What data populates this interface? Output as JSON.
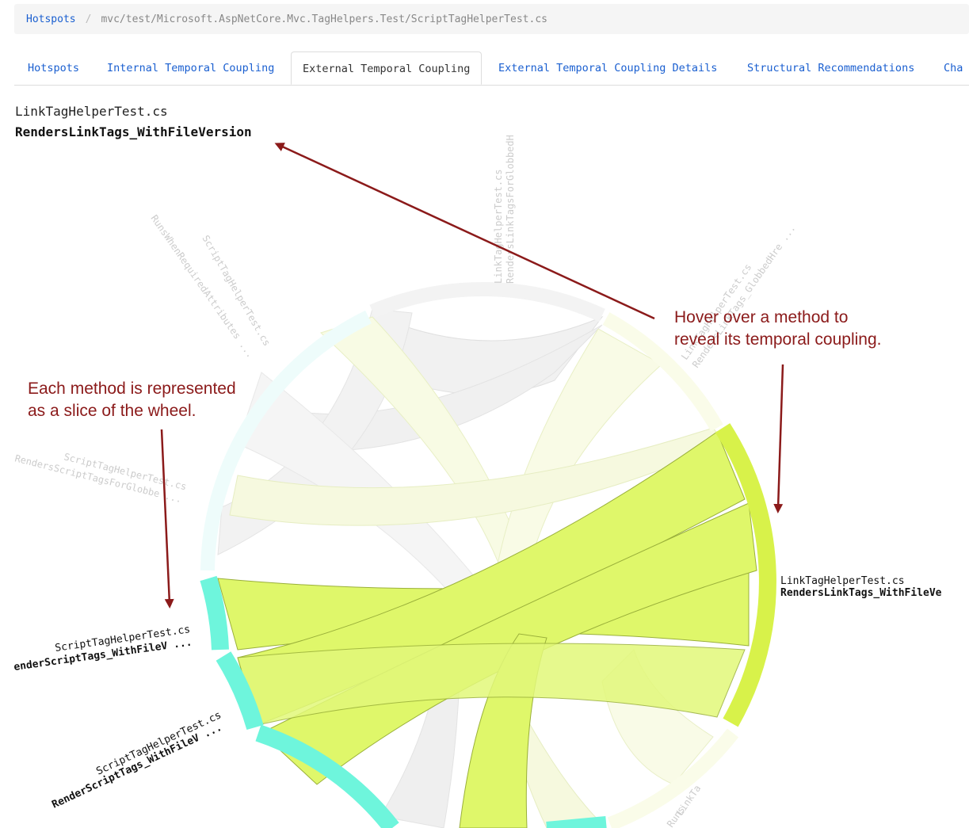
{
  "breadcrumb": {
    "root": "Hotspots",
    "separator": "/",
    "path": "mvc/test/Microsoft.AspNetCore.Mvc.TagHelpers.Test/ScriptTagHelperTest.cs"
  },
  "tabs": [
    {
      "label": "Hotspots",
      "active": false
    },
    {
      "label": "Internal Temporal Coupling",
      "active": false
    },
    {
      "label": "External Temporal Coupling",
      "active": true
    },
    {
      "label": "External Temporal Coupling Details",
      "active": false
    },
    {
      "label": "Structural Recommendations",
      "active": false
    },
    {
      "label": "Cha",
      "active": false
    }
  ],
  "selected": {
    "file": "LinkTagHelperTest.cs",
    "method": "RendersLinkTags_WithFileVersion"
  },
  "annotations": {
    "hover_line1": "Hover over a method to",
    "hover_line2": "reveal its temporal coupling.",
    "slice_line1": "Each method is represented",
    "slice_line2": "as a slice of the wheel."
  },
  "wheel_labels": {
    "right_file": "LinkTagHelperTest.cs",
    "right_method": "RendersLinkTags_WithFileVe",
    "left1_file": "ScriptTagHelperTest.cs",
    "left1_method": "enderScriptTags_WithFileV ...",
    "left2_file": "ScriptTagHelperTest.cs",
    "left2_method": "RenderScriptTags_WithFileV ...",
    "top_file": "LinkTagHelperTest.cs",
    "top_method": "RendersLinkTagsForGlobbedH",
    "topright_file": "LinkTagHelperTest.cs",
    "topright_method": "RendersLinkTags_GlobbedHre ...",
    "topleft_file": "ScriptTagHelperTest.cs",
    "topleft_method": "RunsWhenRequiredAttributes ...",
    "left3_file": "ScriptTagHelperTest.cs",
    "left3_method": "RendersScriptTagsForGlobbe ...",
    "bottom_file": "LinkTa",
    "bottom_method": "Runs"
  },
  "colors": {
    "link_blue": "#1a5fd0",
    "annotation_red": "#8b1a1a",
    "highlight_chord": "#dff76a",
    "highlight_arc": "#d8f24a",
    "script_arc": "#6ef5dc"
  }
}
